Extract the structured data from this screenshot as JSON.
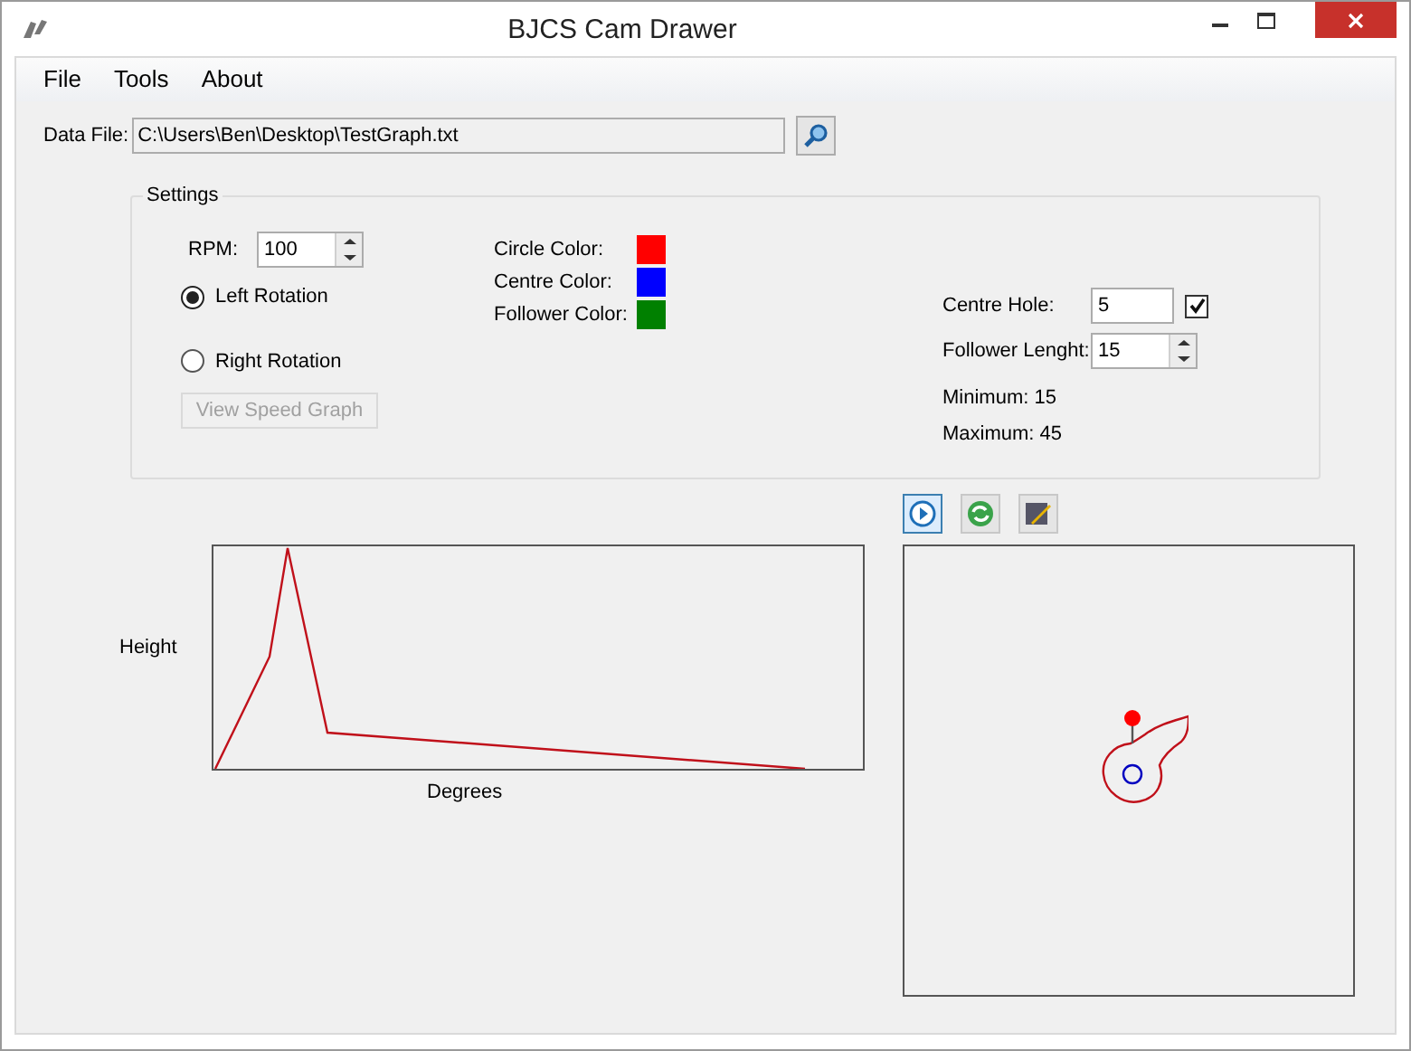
{
  "window": {
    "title": "BJCS Cam Drawer"
  },
  "menu": [
    "File",
    "Tools",
    "About"
  ],
  "data_file": {
    "label": "Data File:",
    "value": "C:\\Users\\Ben\\Desktop\\TestGraph.txt"
  },
  "settings": {
    "title": "Settings",
    "rpm": {
      "label": "RPM:",
      "value": "100"
    },
    "rotation": [
      {
        "label": "Left Rotation",
        "selected": true
      },
      {
        "label": "Right Rotation",
        "selected": false
      }
    ],
    "speed_button": {
      "label": "View Speed Graph",
      "disabled": true
    },
    "colors": [
      {
        "label": "Circle Color:",
        "color": "#ff0000"
      },
      {
        "label": "Centre Color:",
        "color": "#0000ff"
      },
      {
        "label": "Follower Color:",
        "color": "#008000"
      }
    ],
    "centre_hole": {
      "label": "Centre Hole:",
      "value": "5",
      "checked": true
    },
    "follower_length": {
      "label": "Follower Lenght:",
      "value": "15"
    },
    "minimum": "Minimum: 15",
    "maximum": "Maximum: 45"
  },
  "graph": {
    "ylabel": "Height",
    "xlabel": "Degrees"
  }
}
